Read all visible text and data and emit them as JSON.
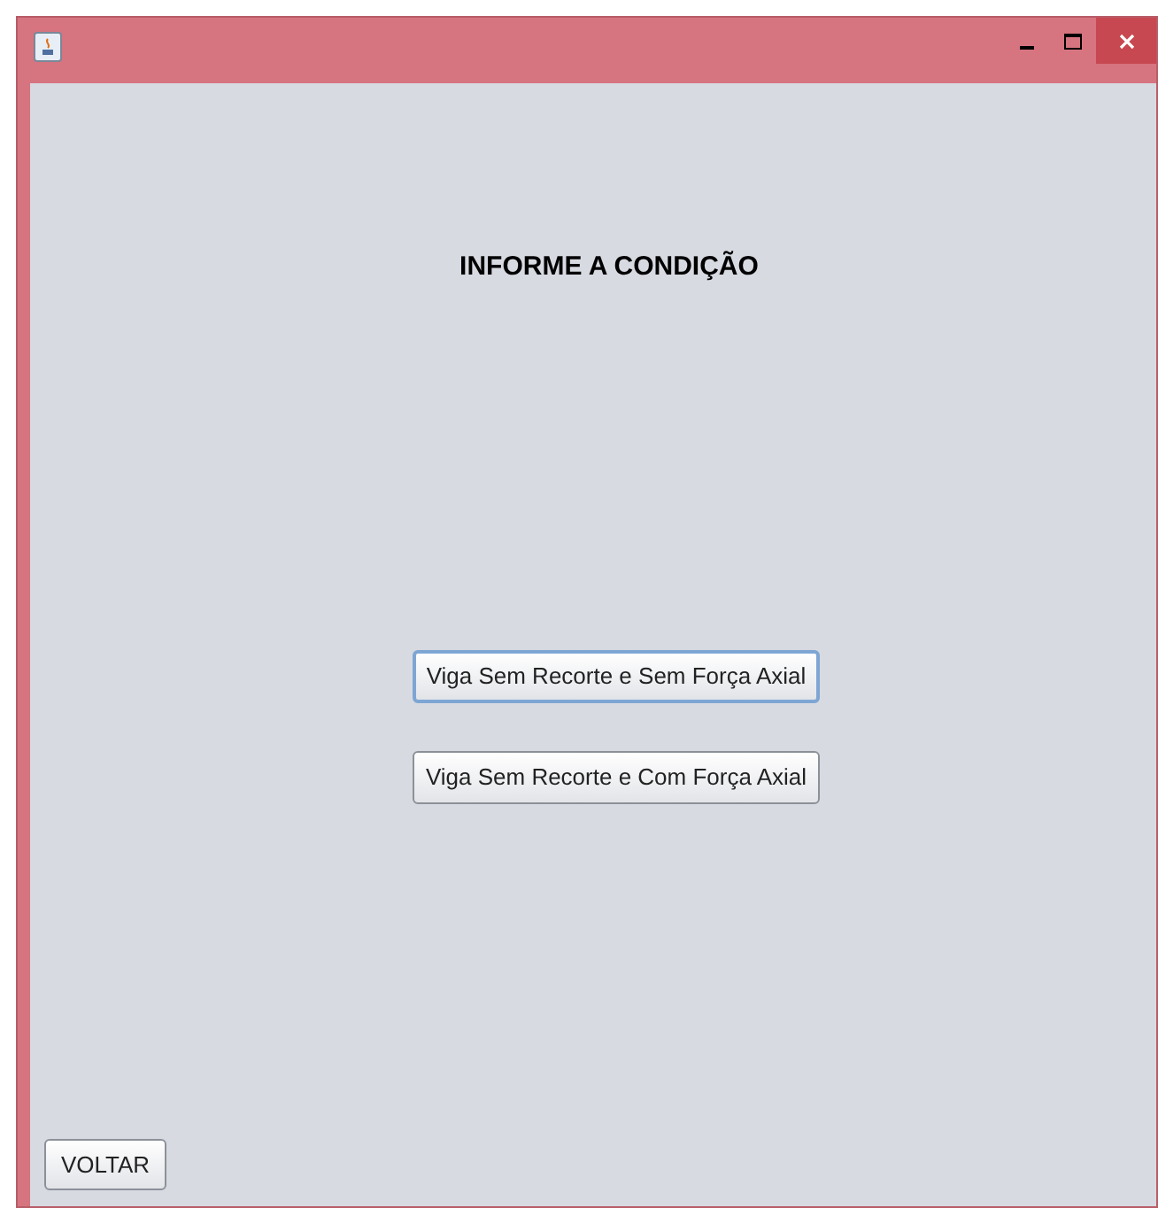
{
  "heading": "INFORME A CONDIÇÃO",
  "options": [
    {
      "label": "Viga Sem Recorte e Sem Força Axial",
      "focused": true
    },
    {
      "label": "Viga Sem Recorte e Com Força Axial",
      "focused": false
    }
  ],
  "back_button": "VOLTAR"
}
